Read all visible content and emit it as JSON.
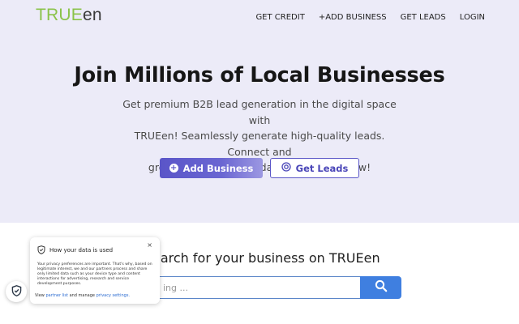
{
  "brand": {
    "logo_true": "TRUE",
    "logo_en": "en"
  },
  "nav": {
    "get_credit": "GET CREDIT",
    "add_business": "+ADD BUSINESS",
    "get_leads": "GET LEADS",
    "login": "LOGIN"
  },
  "hero": {
    "headline": "Join Millions of Local Businesses",
    "subtext_lines": [
      "Get premium B2B lead generation in the digital space with",
      "TRUEen! Seamlessly generate high-quality leads. Connect and",
      "grow your business today. Join for free now!"
    ],
    "add_business_label": "Add Business",
    "get_leads_label": "Get Leads"
  },
  "search": {
    "title": "earch for your business on TRUEen",
    "placeholder": "ing ..."
  },
  "consent": {
    "title": "How your data is used",
    "close": "×",
    "body": "Your privacy preferences are important. That's why, based on legitimate interest, we and our partners process and share only limited data such as your device type and content interactions for advertising, research and service development purposes.",
    "footer_view": "View",
    "partner_list": "partner list",
    "footer_and": "and manage",
    "privacy_settings": "privacy settings."
  },
  "icons": {
    "add": "plus-circle-icon",
    "leads": "target-icon",
    "search": "search-icon",
    "shield": "shield-icon"
  },
  "colors": {
    "hero_bg": "#ecebf8",
    "accent": "#5a55c8",
    "logo_green": "#8bc34a",
    "search_blue": "#3f7fe0"
  }
}
